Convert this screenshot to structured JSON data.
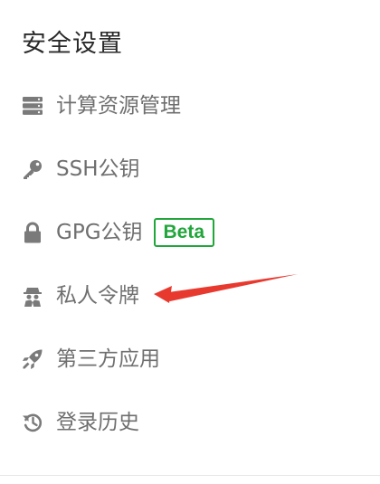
{
  "settings": {
    "title": "安全设置",
    "items": [
      {
        "id": "compute",
        "label": "计算资源管理",
        "icon": "server-icon"
      },
      {
        "id": "ssh",
        "label": "SSH公钥",
        "icon": "key-icon"
      },
      {
        "id": "gpg",
        "label": "GPG公钥",
        "icon": "lock-icon",
        "badge": "Beta"
      },
      {
        "id": "token",
        "label": "私人令牌",
        "icon": "incognito-icon"
      },
      {
        "id": "apps",
        "label": "第三方应用",
        "icon": "rocket-icon"
      },
      {
        "id": "history",
        "label": "登录历史",
        "icon": "history-icon"
      }
    ]
  },
  "colors": {
    "icon": "#7a7a7a",
    "badge": "#21a63b",
    "arrow": "#e8392f"
  }
}
